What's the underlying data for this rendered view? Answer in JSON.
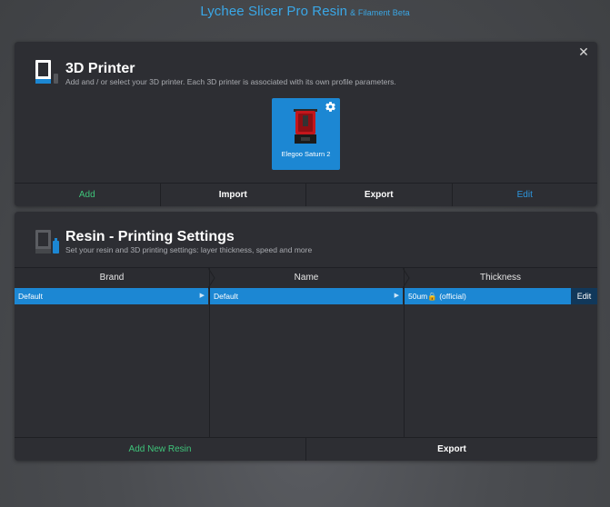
{
  "app": {
    "title": "Lychee Slicer Pro Resin",
    "subtitle": "& Filament Beta"
  },
  "colors": {
    "accent_blue": "#1c87d3",
    "title_blue": "#3aa7e6",
    "add_green": "#3fc47a",
    "panel_bg": "#2d2e33"
  },
  "printer_panel": {
    "close_glyph": "✕",
    "icon": "printer-icon",
    "title": "3D Printer",
    "description": "Add and / or select your 3D printer. Each 3D printer is associated with its own profile parameters.",
    "printers": [
      {
        "label": "Elegoo Saturn 2",
        "selected": true,
        "settings_icon": "gear-icon"
      }
    ],
    "actions": {
      "add": "Add",
      "import": "Import",
      "export": "Export",
      "edit": "Edit"
    }
  },
  "resin_panel": {
    "icon": "resin-printer-icon",
    "title": "Resin - Printing Settings",
    "description": "Set your resin and 3D printing settings: layer thickness, speed and more",
    "columns": [
      "Brand",
      "Name",
      "Thickness"
    ],
    "selected_row": {
      "brand": "Default",
      "name": "Default",
      "thickness": "50um🔒 (official)"
    },
    "edit_label": "Edit",
    "actions": {
      "add_new_resin": "Add New Resin",
      "export": "Export"
    }
  }
}
